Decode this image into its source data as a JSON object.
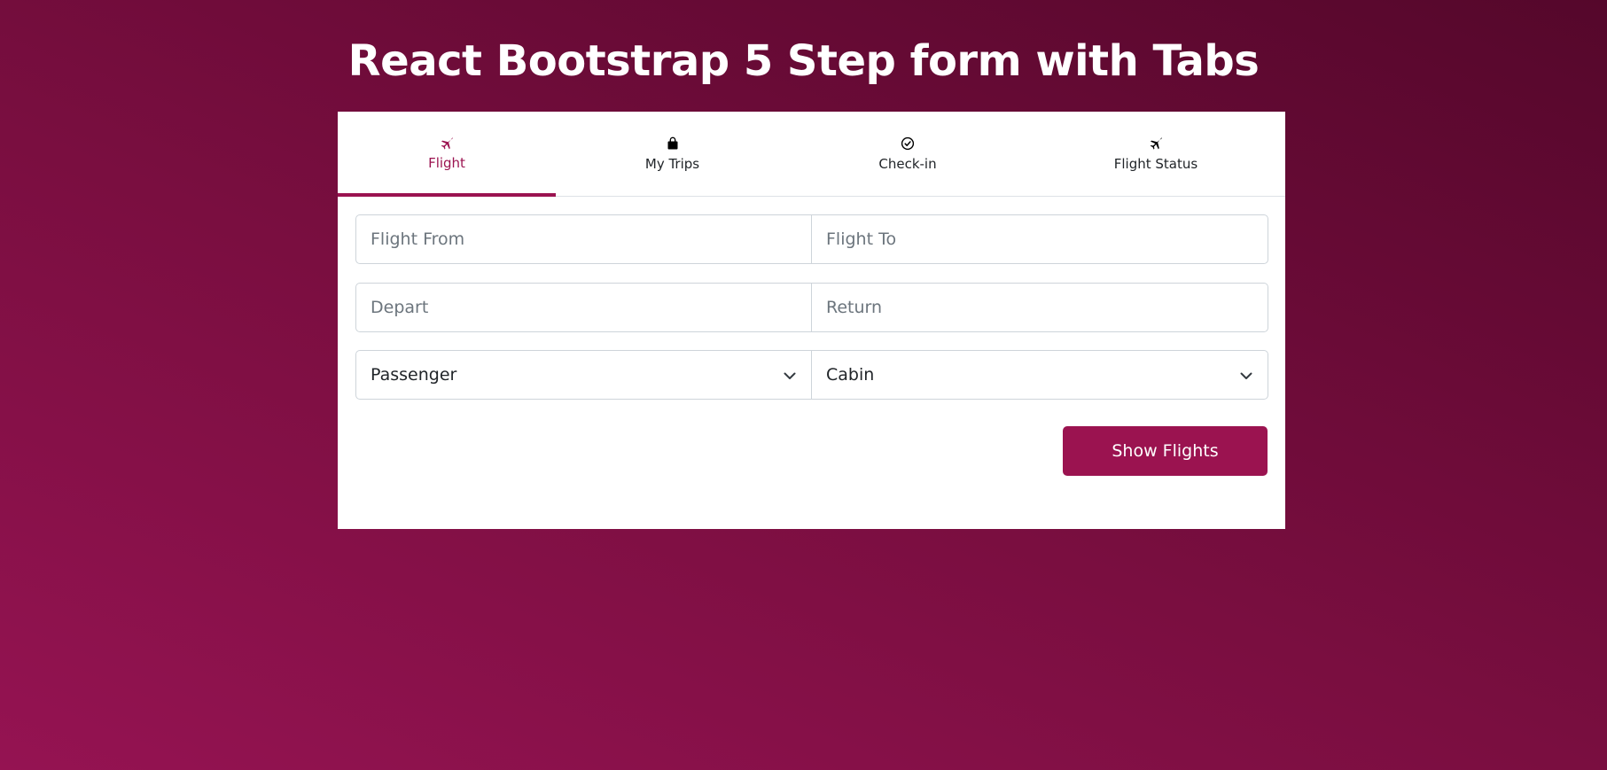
{
  "page": {
    "title": "React Bootstrap 5 Step form with Tabs"
  },
  "theme": {
    "accent": "#9b1350",
    "background_top": "#55072b",
    "background_bottom": "#951352"
  },
  "tabs": [
    {
      "label": "Flight",
      "icon": "plane-icon",
      "active": true
    },
    {
      "label": "My Trips",
      "icon": "shopping-bag-icon",
      "active": false
    },
    {
      "label": "Check-in",
      "icon": "check-circle-icon",
      "active": false
    },
    {
      "label": "Flight Status",
      "icon": "plane-icon",
      "active": false
    }
  ],
  "form": {
    "flight_from": {
      "placeholder": "Flight From",
      "value": ""
    },
    "flight_to": {
      "placeholder": "Flight To",
      "value": ""
    },
    "depart": {
      "placeholder": "Depart",
      "value": ""
    },
    "return": {
      "placeholder": "Return",
      "value": ""
    },
    "passenger": {
      "selected": "Passenger"
    },
    "cabin": {
      "selected": "Cabin"
    },
    "submit_label": "Show Flights"
  }
}
